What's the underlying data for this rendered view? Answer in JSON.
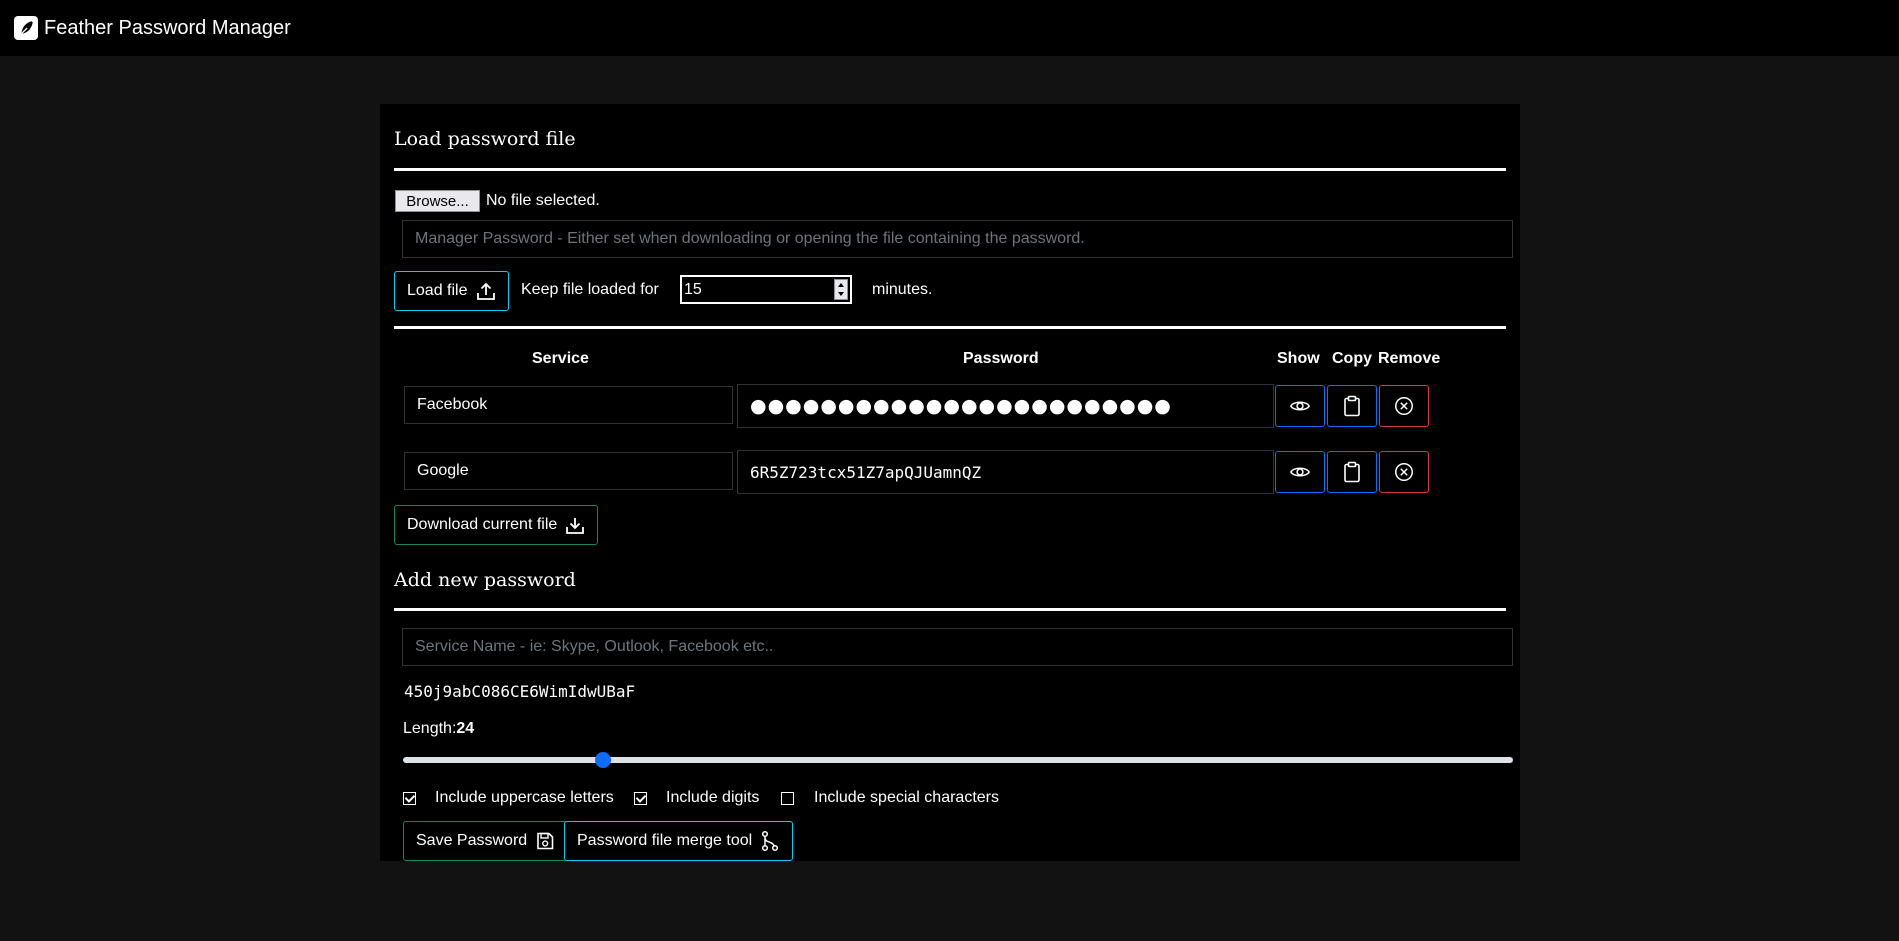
{
  "app": {
    "title": "Feather Password Manager"
  },
  "load_section": {
    "title": "Load password file",
    "browse_label": "Browse...",
    "file_status": "No file selected.",
    "manager_password_placeholder": "Manager Password - Either set when downloading or opening the file containing the password.",
    "load_button": "Load file",
    "keep_label": "Keep file loaded for",
    "keep_value": "15",
    "keep_unit": "minutes."
  },
  "table": {
    "headers": {
      "service": "Service",
      "password": "Password",
      "show": "Show",
      "copy": "Copy",
      "remove": "Remove"
    },
    "rows": [
      {
        "service": "Facebook",
        "password": "●●●●●●●●●●●●●●●●●●●●●●●●"
      },
      {
        "service": "Google",
        "password": "6R5Z723tcx51Z7apQJUamnQZ"
      }
    ]
  },
  "download_button": "Download current file",
  "add_section": {
    "title": "Add new password",
    "service_placeholder": "Service Name - ie: Skype, Outlook, Facebook etc..",
    "generated_password": "450j9abC086CE6WimIdwUBaF",
    "length_label": "Length:",
    "length_value": "24",
    "length_fraction": 0.18,
    "options": [
      {
        "label": "Include uppercase letters",
        "checked": true
      },
      {
        "label": "Include digits",
        "checked": true
      },
      {
        "label": "Include special characters",
        "checked": false
      }
    ],
    "save_button": "Save Password",
    "merge_button": "Password file merge tool"
  },
  "icons": {
    "logo": "feather-pen-icon",
    "upload": "upload-icon",
    "download": "download-icon",
    "show": "eye-icon",
    "copy": "clipboard-icon",
    "remove": "x-circle-icon",
    "save": "floppy-disk-icon",
    "merge": "git-branch-icon"
  },
  "colors": {
    "info": "#0dcaf0",
    "success": "#198754",
    "primary": "#0d6efd",
    "danger": "#dc3545"
  }
}
